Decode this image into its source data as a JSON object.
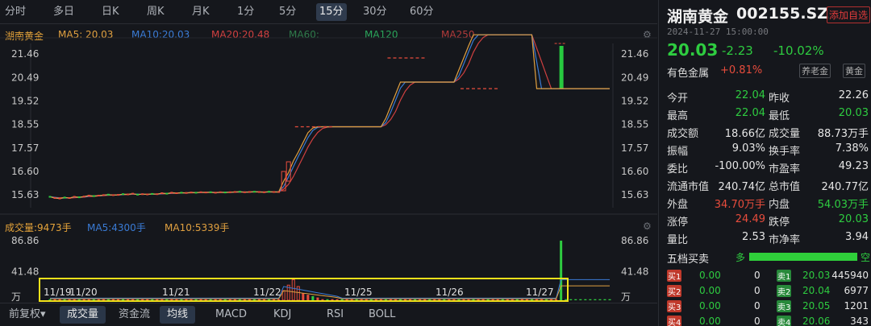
{
  "period_tabs": [
    "分时",
    "多日",
    "日K",
    "周K",
    "月K",
    "1分",
    "5分",
    "15分",
    "30分",
    "60分"
  ],
  "active_period": "15分",
  "legend_main": {
    "name": "湖南黄金",
    "ma5": "MA5: 20.03",
    "ma10": "MA10:20.03",
    "ma20": "MA20:20.48",
    "ma60": "MA60:",
    "ma120": "MA120",
    "ma250": "MA250"
  },
  "legend_vol": {
    "vol": "成交量:9473手",
    "ma5": "MA5:4300手",
    "ma10": "MA10:5339手"
  },
  "colors": {
    "up": "#e74c3c",
    "down": "#2ecc40",
    "ma5": "#e0a040",
    "ma10": "#3a7bd5",
    "ma20": "#d04040",
    "ma60": "#2f7a4a",
    "ma120": "#2aa45a",
    "ma250": "#b03a3a",
    "highlight_box": "#f3e21a"
  },
  "price_axis_left": [
    "21.46",
    "20.49",
    "19.52",
    "18.55",
    "17.57",
    "16.60",
    "15.63"
  ],
  "price_axis_right": [
    "21.46",
    "20.49",
    "19.52",
    "18.55",
    "17.57",
    "16.60",
    "15.63"
  ],
  "vol_axis": [
    "86.86",
    "41.48",
    "万"
  ],
  "date_labels": [
    "11/19",
    "11/20",
    "11/21",
    "11/22",
    "11/25",
    "11/26",
    "11/27"
  ],
  "bottom_tabs": [
    "前复权▾",
    "成交量",
    "资金流",
    "均线",
    "MACD",
    "KDJ",
    "RSI",
    "BOLL"
  ],
  "bottom_active": [
    "成交量",
    "均线"
  ],
  "chart_data": {
    "type": "candlestick",
    "price_range": [
      15.1,
      21.9
    ],
    "volume_range": [
      0,
      95
    ],
    "close_series": [
      15.55,
      15.5,
      15.48,
      15.52,
      15.5,
      15.55,
      15.53,
      15.56,
      15.6,
      15.58,
      15.6,
      15.62,
      15.64,
      15.62,
      15.63,
      15.66,
      15.65,
      15.68,
      15.64,
      15.66,
      15.65,
      15.67,
      15.66,
      15.7,
      15.68,
      15.72,
      15.7,
      15.72,
      15.71,
      15.73,
      15.72,
      15.74,
      15.73,
      15.74,
      15.72,
      15.74,
      15.73,
      15.74,
      15.75,
      15.76,
      15.74,
      15.75,
      15.76,
      15.75,
      15.74,
      15.76,
      15.75,
      15.75,
      16.2,
      16.55,
      17.03,
      17.4,
      17.8,
      18.2,
      18.4,
      18.45,
      18.45,
      18.45,
      18.45,
      18.45,
      18.45,
      18.45,
      18.45,
      18.45,
      18.45,
      18.45,
      18.45,
      18.45,
      18.45,
      18.8,
      19.3,
      19.8,
      20.3,
      20.3,
      20.3,
      20.3,
      20.3,
      20.3,
      20.3,
      20.3,
      20.3,
      20.3,
      20.3,
      20.3,
      20.8,
      21.3,
      21.8,
      22.26,
      22.26,
      22.26,
      22.26,
      22.26,
      22.26,
      22.26,
      22.26,
      22.26,
      22.26,
      22.26,
      22.26,
      22.26,
      20.03,
      20.03,
      20.03,
      20.03,
      20.03,
      20.03,
      20.03,
      20.03,
      20.03,
      20.03,
      20.03,
      20.03,
      20.03,
      20.03,
      20.03,
      20.03
    ],
    "limit_up_days": [
      "11/22",
      "11/25",
      "11/26"
    ],
    "limit_down_day": "11/27",
    "volume_peak": 86.86,
    "volume_unit": "万"
  },
  "panel": {
    "name": "湖南黄金",
    "code": "002155.SZ",
    "add_watch": "添加自选",
    "timestamp": "2024-11-27 15:00:00",
    "price": "20.03",
    "change": "-2.23",
    "change_pct": "-10.02%",
    "sector": "有色金属",
    "sector_pct": "+0.81%",
    "btn1": "养老金",
    "btn2": "黄金",
    "stats": [
      {
        "l": "今开",
        "v": "22.04",
        "vc": "green",
        "l2": "昨收",
        "v2": "22.26",
        "vc2": "white"
      },
      {
        "l": "最高",
        "v": "22.04",
        "vc": "green",
        "l2": "最低",
        "v2": "20.03",
        "vc2": "green"
      },
      {
        "l": "成交额",
        "v": "18.66亿",
        "vc": "white",
        "l2": "成交量",
        "v2": "88.73万手",
        "vc2": "white"
      },
      {
        "l": "振幅",
        "v": "9.03%",
        "vc": "white",
        "l2": "换手率",
        "v2": "7.38%",
        "vc2": "white"
      },
      {
        "l": "委比",
        "v": "-100.00%",
        "vc": "white",
        "l2": "市盈率",
        "v2": "49.23",
        "vc2": "white"
      },
      {
        "l": "流通市值",
        "v": "240.74亿",
        "vc": "white",
        "l2": "总市值",
        "v2": "240.77亿",
        "vc2": "white"
      },
      {
        "l": "外盘",
        "v": "34.70万手",
        "vc": "red",
        "l2": "内盘",
        "v2": "54.03万手",
        "vc2": "green"
      },
      {
        "l": "涨停",
        "v": "24.49",
        "vc": "red",
        "l2": "跌停",
        "v2": "20.03",
        "vc2": "green"
      },
      {
        "l": "量比",
        "v": "2.53",
        "vc": "white",
        "l2": "市净率",
        "v2": "3.94",
        "vc2": "white"
      }
    ],
    "book_title": "五档买卖",
    "book_duo": "多",
    "book_kong": "空",
    "book_rows": [
      {
        "bl": "买1",
        "bp": "0.00",
        "bv": "0",
        "sl": "卖1",
        "sp": "20.03",
        "sv": "445940"
      },
      {
        "bl": "买2",
        "bp": "0.00",
        "bv": "0",
        "sl": "卖2",
        "sp": "20.04",
        "sv": "6977"
      },
      {
        "bl": "买3",
        "bp": "0.00",
        "bv": "0",
        "sl": "卖3",
        "sp": "20.05",
        "sv": "1201"
      },
      {
        "bl": "买4",
        "bp": "0.00",
        "bv": "0",
        "sl": "卖4",
        "sp": "20.06",
        "sv": "343"
      }
    ]
  }
}
